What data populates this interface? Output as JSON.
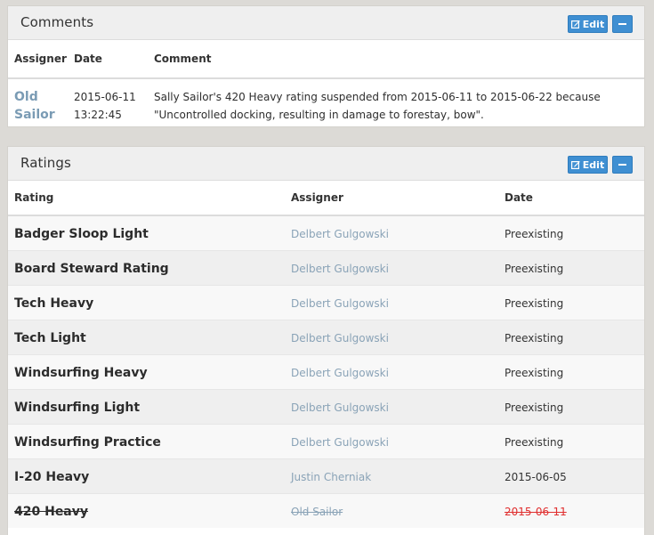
{
  "comments": {
    "title": "Comments",
    "edit_label": "Edit",
    "columns": {
      "assigner": "Assigner",
      "date": "Date",
      "comment": "Comment"
    },
    "rows": [
      {
        "assigner_line1": "Old",
        "assigner_line2": "Sailor",
        "date_line1": "2015-06-11",
        "date_line2": "13:22:45",
        "comment_line1": "Sally Sailor's 420 Heavy rating suspended from 2015-06-11 to 2015-06-22 because",
        "comment_line2": "\"Uncontrolled docking, resulting in damage to forestay, bow\"."
      }
    ]
  },
  "ratings": {
    "title": "Ratings",
    "edit_label": "Edit",
    "columns": {
      "rating": "Rating",
      "assigner": "Assigner",
      "date": "Date"
    },
    "rows": [
      {
        "rating": "Badger Sloop Light",
        "assigner": "Delbert Gulgowski",
        "date": "Preexisting"
      },
      {
        "rating": "Board Steward Rating",
        "assigner": "Delbert Gulgowski",
        "date": "Preexisting"
      },
      {
        "rating": "Tech Heavy",
        "assigner": "Delbert Gulgowski",
        "date": "Preexisting"
      },
      {
        "rating": "Tech Light",
        "assigner": "Delbert Gulgowski",
        "date": "Preexisting"
      },
      {
        "rating": "Windsurfing Heavy",
        "assigner": "Delbert Gulgowski",
        "date": "Preexisting"
      },
      {
        "rating": "Windsurfing Light",
        "assigner": "Delbert Gulgowski",
        "date": "Preexisting"
      },
      {
        "rating": "Windsurfing Practice",
        "assigner": "Delbert Gulgowski",
        "date": "Preexisting"
      },
      {
        "rating": "I-20 Heavy",
        "assigner": "Justin Cherniak",
        "date": "2015-06-05"
      },
      {
        "rating": "420 Heavy",
        "assigner": "Old Sailor",
        "date": "2015-06-11",
        "revoked": true
      }
    ]
  },
  "colors": {
    "page_bg": "#dcdad6",
    "accent_button": "#3f8fd2",
    "link": "#8aa3b7",
    "revoked_date": "#e03030"
  },
  "icons": {
    "edit": "edit-square-icon",
    "collapse": "minus-icon"
  }
}
